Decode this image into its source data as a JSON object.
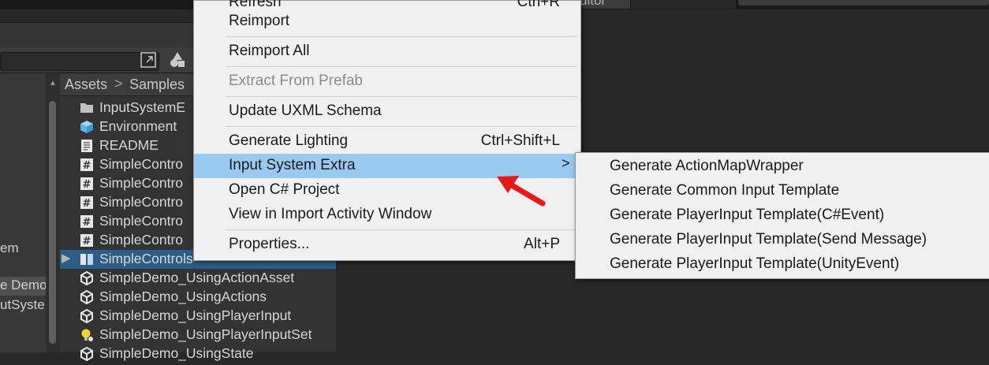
{
  "editor": {
    "tab_right_label": "ditor",
    "breadcrumb": {
      "root": "Assets",
      "separator": ">",
      "current": "Samples"
    },
    "hierarchy": [
      "em",
      "e Demo",
      "utSyste"
    ],
    "project_items": [
      {
        "icon": "folder-icon",
        "label": "InputSystemE"
      },
      {
        "icon": "prefab-cube-icon",
        "label": "Environment"
      },
      {
        "icon": "text-document-icon",
        "label": "README"
      },
      {
        "icon": "csharp-script-icon",
        "label": "SimpleContro"
      },
      {
        "icon": "csharp-script-icon",
        "label": "SimpleContro"
      },
      {
        "icon": "csharp-script-icon",
        "label": "SimpleContro"
      },
      {
        "icon": "csharp-script-icon",
        "label": "SimpleContro"
      },
      {
        "icon": "csharp-script-icon",
        "label": "SimpleContro"
      },
      {
        "icon": "input-actions-icon",
        "label": "SimpleControls"
      },
      {
        "icon": "unity-scene-icon",
        "label": "SimpleDemo_UsingActionAsset"
      },
      {
        "icon": "unity-scene-icon",
        "label": "SimpleDemo_UsingActions"
      },
      {
        "icon": "unity-scene-icon",
        "label": "SimpleDemo_UsingPlayerInput"
      },
      {
        "icon": "lightbulb-settings-icon",
        "label": "SimpleDemo_UsingPlayerInputSet"
      },
      {
        "icon": "unity-scene-icon",
        "label": "SimpleDemo_UsingState"
      }
    ]
  },
  "context_menu": {
    "items": [
      {
        "label": "Refresh",
        "shortcut": "Ctrl+R"
      },
      {
        "label": "Reimport",
        "shortcut": ""
      },
      {
        "label": "Reimport All",
        "shortcut": ""
      },
      {
        "label": "Extract From Prefab",
        "shortcut": "",
        "disabled": true
      },
      {
        "label": "Update UXML Schema",
        "shortcut": ""
      },
      {
        "label": "Generate Lighting",
        "shortcut": "Ctrl+Shift+L"
      },
      {
        "label": "Input System Extra",
        "shortcut": "",
        "submenu": true,
        "highlighted": true
      },
      {
        "label": "Open C# Project",
        "shortcut": ""
      },
      {
        "label": "View in Import Activity Window",
        "shortcut": ""
      },
      {
        "label": "Properties...",
        "shortcut": "Alt+P"
      }
    ],
    "submenu_arrow": ">"
  },
  "submenu": {
    "items": [
      "Generate ActionMapWrapper",
      "Generate Common Input Template",
      "Generate PlayerInput Template(C#Event)",
      "Generate PlayerInput Template(Send Message)",
      "Generate PlayerInput Template(UnityEvent)"
    ]
  },
  "annotation": {
    "color": "#e81818"
  }
}
